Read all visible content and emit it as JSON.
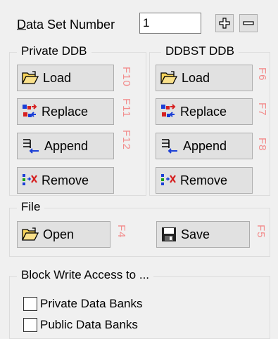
{
  "dataset": {
    "label_underlined": "D",
    "label_rest": "ata Set Number",
    "value": "1"
  },
  "private_ddb": {
    "title": "Private DDB",
    "load": "Load",
    "replace": "Replace",
    "append": "Append",
    "remove": "Remove",
    "hotkeys": [
      "F10",
      "F11",
      "F12"
    ]
  },
  "ddbst_ddb": {
    "title": "DDBST DDB",
    "load": "Load",
    "replace": "Replace",
    "append": "Append",
    "remove": "Remove",
    "hotkeys": [
      "F6",
      "F7",
      "F8"
    ]
  },
  "file": {
    "title": "File",
    "open": "Open",
    "save": "Save",
    "hotkeys": [
      "F4",
      "F5"
    ]
  },
  "block_write": {
    "title": "Block Write Access to ...",
    "private_label": "Private Data Banks",
    "private_checked": false,
    "public_label": "Public Data Banks",
    "public_checked": false
  },
  "icons": {
    "load": "folder-open-icon",
    "replace": "replace-arrows-icon",
    "append": "append-icon",
    "remove": "remove-icon",
    "save": "floppy-disk-icon",
    "plus": "plus-icon",
    "minus": "minus-icon"
  },
  "colors": {
    "hotkey_text": "#f28b8b",
    "button_bg": "#e1e1e1",
    "window_bg": "#f0f0f0"
  }
}
